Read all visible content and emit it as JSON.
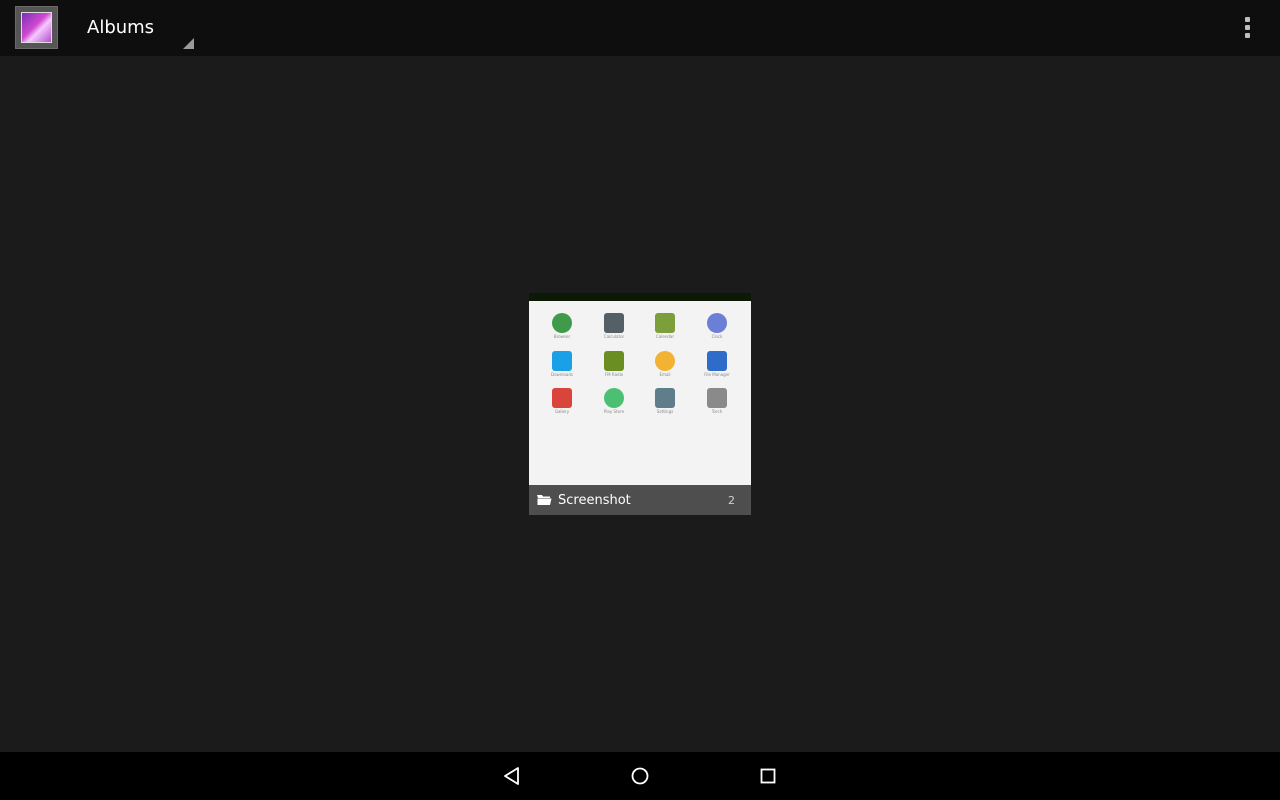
{
  "actionbar": {
    "title": "Albums",
    "app_icon": "gallery-icon",
    "menu_icon": "overflow-menu-icon"
  },
  "album": {
    "name": "Screenshot",
    "count": "2",
    "folder_icon": "folder-icon",
    "thumbnail_apps": [
      {
        "label": "Browser",
        "icon": "browser-icon",
        "color": "#3f9b4a"
      },
      {
        "label": "Calculator",
        "icon": "calculator-icon",
        "color": "#555f66"
      },
      {
        "label": "Calendar",
        "icon": "calendar-icon",
        "color": "#7c9f3b"
      },
      {
        "label": "Clock",
        "icon": "clock-icon",
        "color": "#6b7fd6"
      },
      {
        "label": "Downloads",
        "icon": "downloads-icon",
        "color": "#1aa0e6"
      },
      {
        "label": "FM Radio",
        "icon": "radio-icon",
        "color": "#6b8e23"
      },
      {
        "label": "Email",
        "icon": "email-icon",
        "color": "#f2b233"
      },
      {
        "label": "File Manager",
        "icon": "file-manager-icon",
        "color": "#2f6cc9"
      },
      {
        "label": "Gallery",
        "icon": "gallery-app-icon",
        "color": "#d9453b"
      },
      {
        "label": "Play Store",
        "icon": "play-store-icon",
        "color": "#4bbf72"
      },
      {
        "label": "Settings",
        "icon": "settings-icon",
        "color": "#607d8b"
      },
      {
        "label": "Torch",
        "icon": "torch-icon",
        "color": "#8a8a8a"
      }
    ]
  },
  "navbar": {
    "back": "back-icon",
    "home": "home-icon",
    "recents": "recents-icon"
  },
  "colors": {
    "background": "#1b1b1b",
    "actionbar": "#0e0e0e",
    "navbar": "#000000"
  }
}
